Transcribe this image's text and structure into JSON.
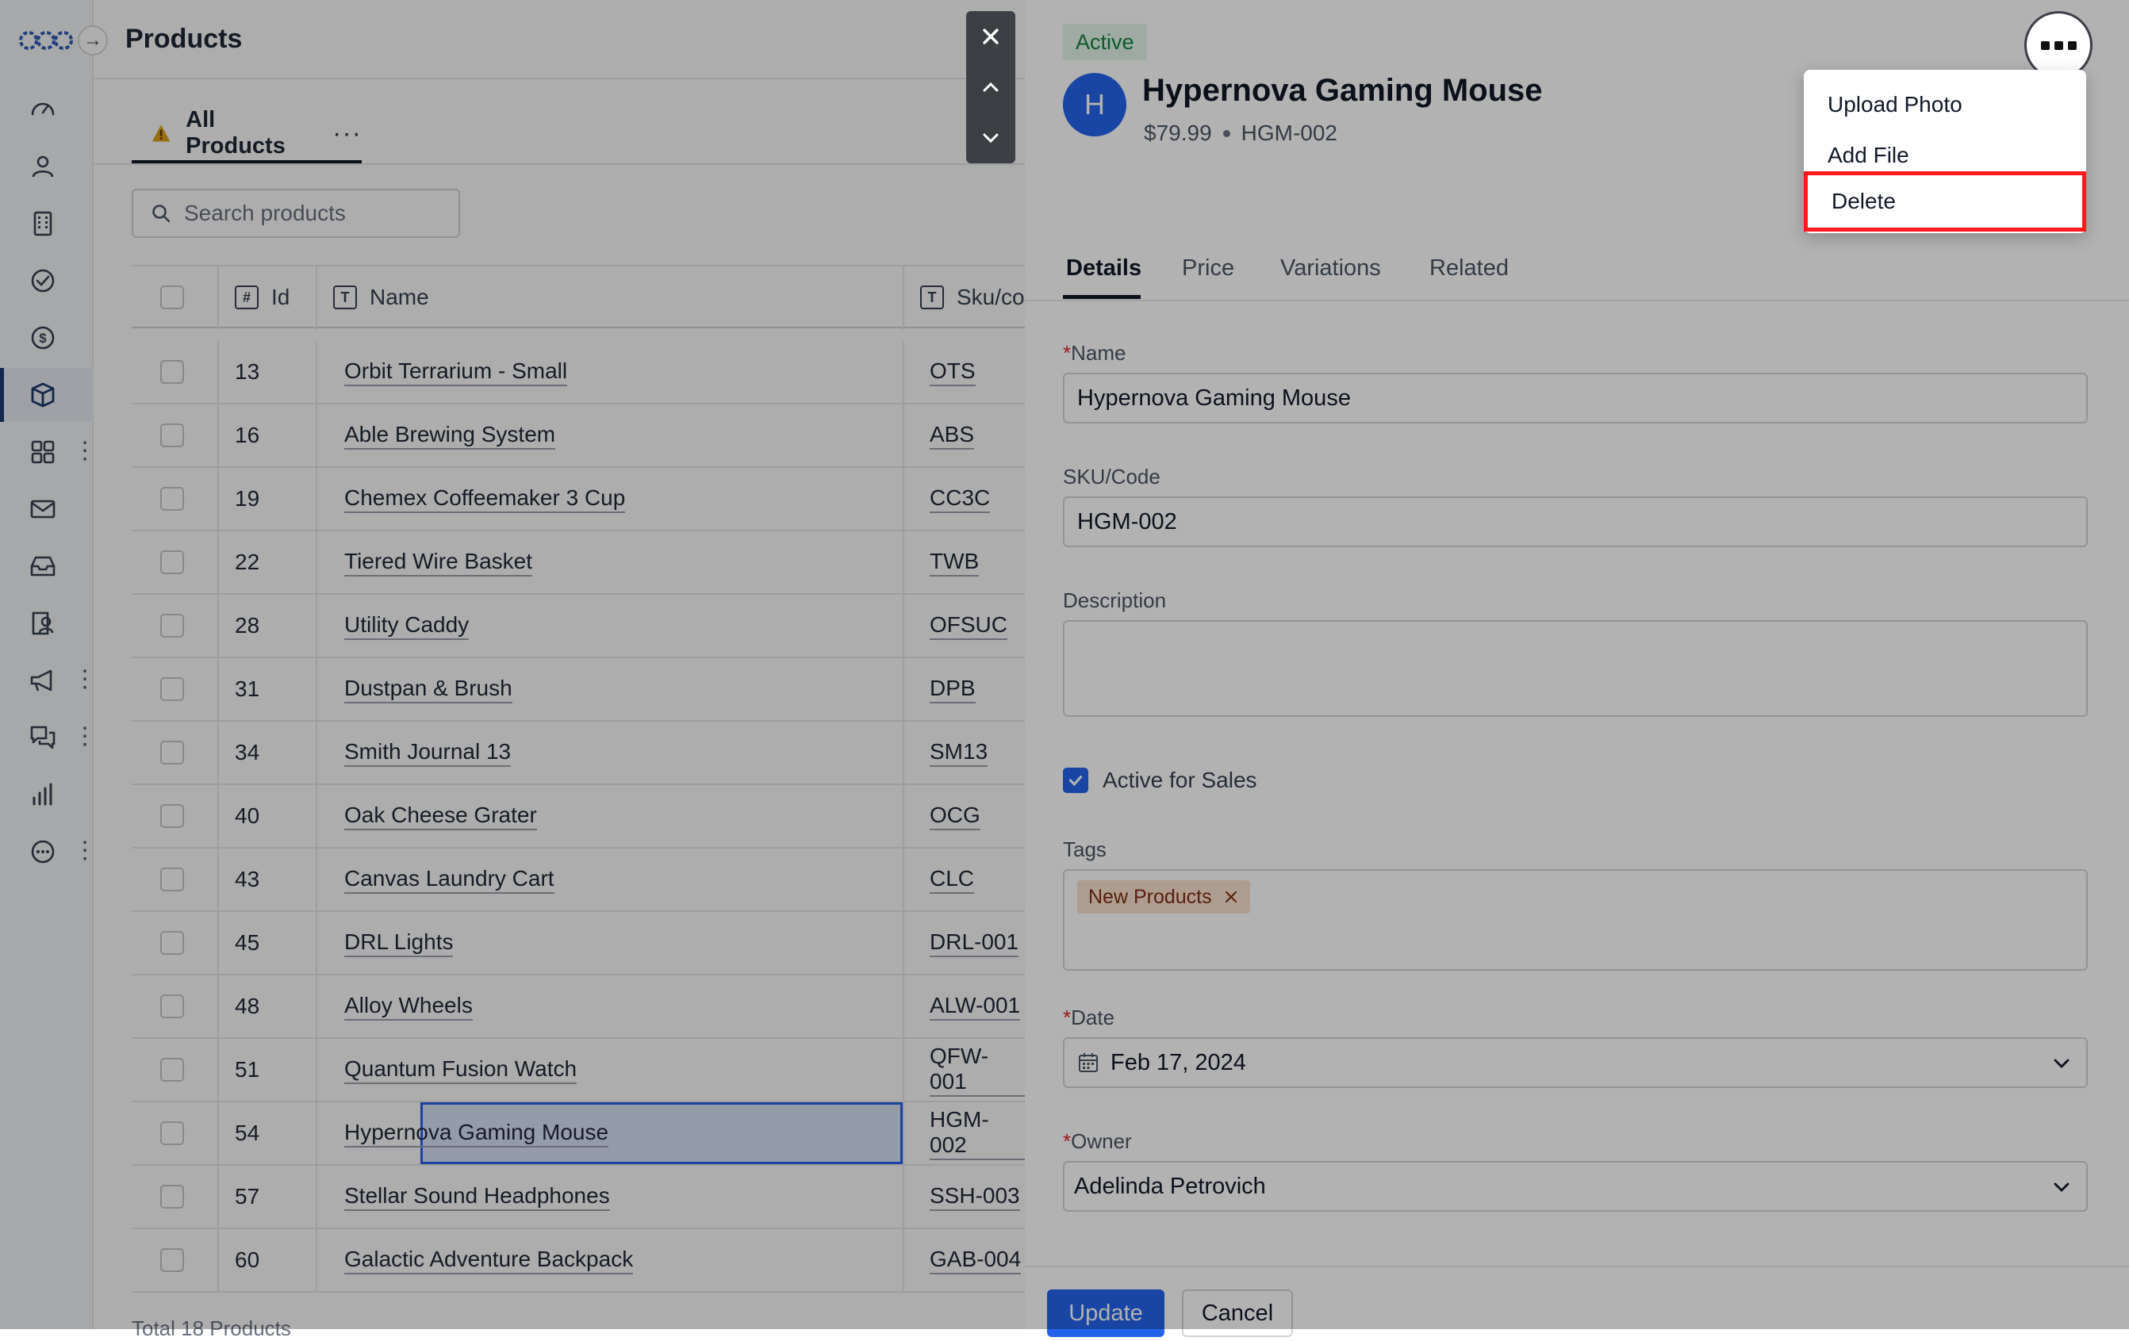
{
  "app": {
    "page_title": "Products",
    "expand_glyph": "→"
  },
  "sidebar": {
    "items": [
      {
        "icon": "dashboard-gauge-icon"
      },
      {
        "icon": "person-icon"
      },
      {
        "icon": "building-icon"
      },
      {
        "icon": "check-circle-icon"
      },
      {
        "icon": "dollar-circle-icon"
      },
      {
        "icon": "box-icon",
        "active": true
      },
      {
        "icon": "apps-grid-icon",
        "has_more": true
      },
      {
        "icon": "mail-icon"
      },
      {
        "icon": "inbox-icon"
      },
      {
        "icon": "contact-card-icon"
      },
      {
        "icon": "megaphone-icon",
        "has_more": true
      },
      {
        "icon": "chat-bubbles-icon",
        "has_more": true
      },
      {
        "icon": "bar-chart-icon"
      },
      {
        "icon": "more-circle-icon",
        "has_more": true
      }
    ],
    "more_glyph": "⋮"
  },
  "list": {
    "view_tab": "All Products",
    "view_more": "···",
    "search_placeholder": "Search products",
    "columns": [
      "Id",
      "Name",
      "Sku/code"
    ],
    "column_icons": [
      "#",
      "T",
      "T"
    ],
    "rows": [
      {
        "id": "13",
        "name": "Orbit Terrarium - Small",
        "sku": "OTS"
      },
      {
        "id": "16",
        "name": "Able Brewing System",
        "sku": "ABS"
      },
      {
        "id": "19",
        "name": "Chemex Coffeemaker 3 Cup",
        "sku": "CC3C"
      },
      {
        "id": "22",
        "name": "Tiered Wire Basket",
        "sku": "TWB"
      },
      {
        "id": "28",
        "name": "Utility Caddy",
        "sku": "OFSUC"
      },
      {
        "id": "31",
        "name": "Dustpan & Brush",
        "sku": "DPB"
      },
      {
        "id": "34",
        "name": "Smith Journal 13",
        "sku": "SM13"
      },
      {
        "id": "40",
        "name": "Oak Cheese Grater",
        "sku": "OCG"
      },
      {
        "id": "43",
        "name": "Canvas Laundry Cart",
        "sku": "CLC"
      },
      {
        "id": "45",
        "name": "DRL Lights",
        "sku": "DRL-001"
      },
      {
        "id": "48",
        "name": "Alloy Wheels",
        "sku": "ALW-001"
      },
      {
        "id": "51",
        "name": "Quantum Fusion Watch",
        "sku": "QFW-001"
      },
      {
        "id": "54",
        "name": "Hypernova Gaming Mouse",
        "sku": "HGM-002",
        "selected": true
      },
      {
        "id": "57",
        "name": "Stellar Sound Headphones",
        "sku": "SSH-003"
      },
      {
        "id": "60",
        "name": "Galactic Adventure Backpack",
        "sku": "GAB-004"
      }
    ],
    "footer": "Total 18 Products"
  },
  "record": {
    "status": "Active",
    "avatar_letter": "H",
    "title": "Hypernova Gaming Mouse",
    "price": "$79.99",
    "sku": "HGM-002",
    "menu": [
      "Upload Photo",
      "Add File",
      "Delete"
    ],
    "tabs": [
      "Details",
      "Price",
      "Variations",
      "Related"
    ],
    "fields": {
      "name_label": "Name",
      "name_value": "Hypernova Gaming Mouse",
      "sku_label": "SKU/Code",
      "sku_value": "HGM-002",
      "description_label": "Description",
      "description_value": "",
      "active_label": "Active for Sales",
      "active_checked": true,
      "tags_label": "Tags",
      "tags": [
        "New Products"
      ],
      "date_label": "Date",
      "date_value": "Feb 17, 2024",
      "owner_label": "Owner",
      "owner_value": "Adelinda Petrovich"
    },
    "required_marker": "*",
    "update_label": "Update",
    "cancel_label": "Cancel"
  },
  "colors": {
    "accent": "#2563eb",
    "highlight": "#ff1a1a",
    "active_badge_bg": "#e3f5e8",
    "tag_bg": "#f8e1cf"
  }
}
